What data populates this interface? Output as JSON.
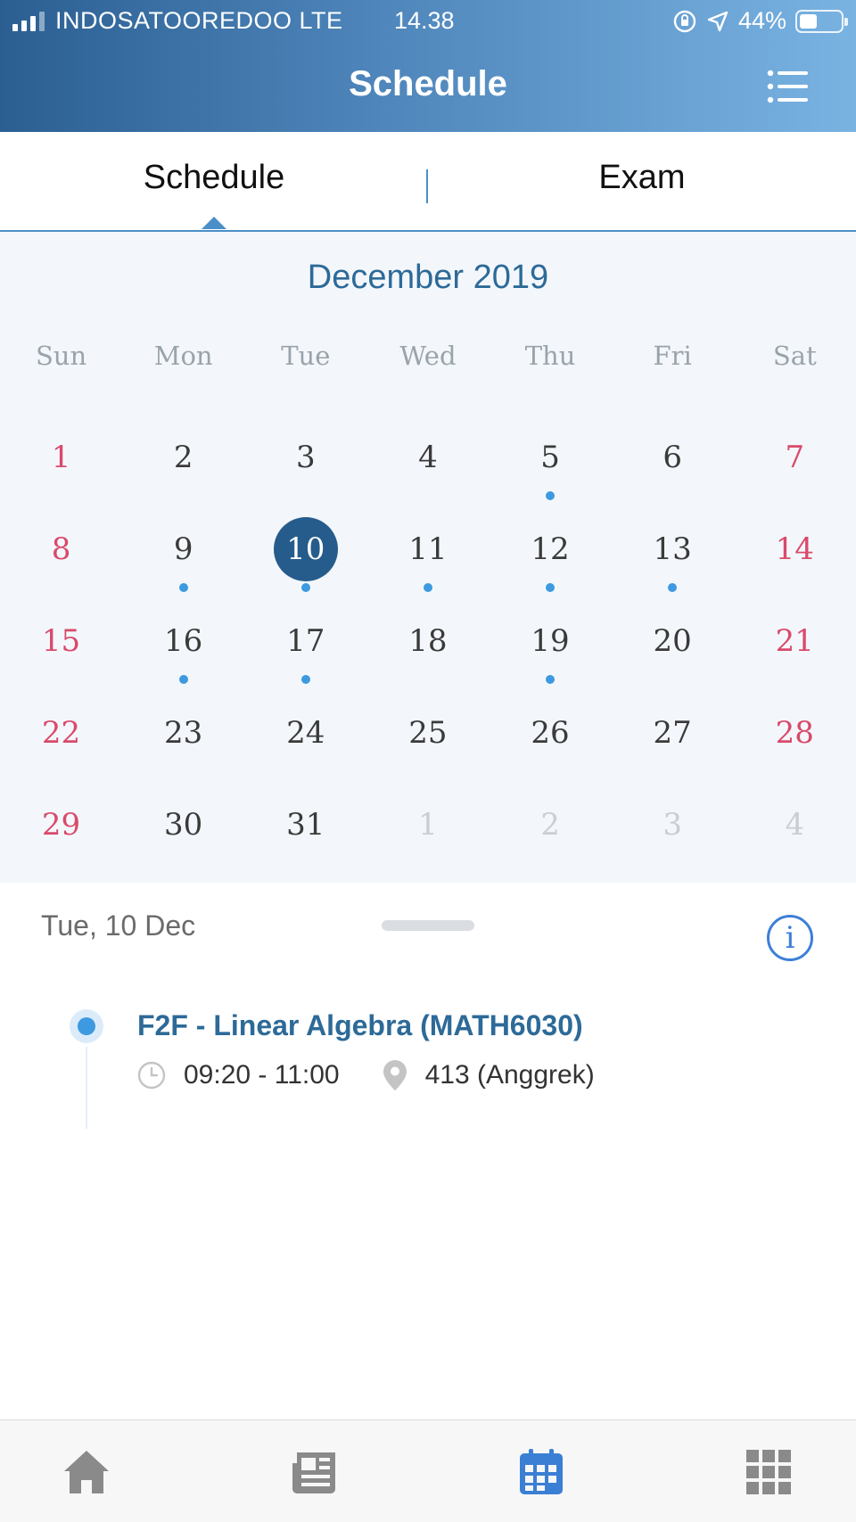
{
  "status_bar": {
    "carrier": "INDOSATOOREDOO LTE",
    "time": "14.38",
    "battery": "44%",
    "battery_level": 0.44
  },
  "header": {
    "title": "Schedule",
    "menu_icon": "list-menu-icon"
  },
  "tabs": [
    {
      "label": "Schedule",
      "active": true
    },
    {
      "label": "Exam",
      "active": false
    }
  ],
  "calendar": {
    "month_label": "December 2019",
    "weekdays": [
      "Sun",
      "Mon",
      "Tue",
      "Wed",
      "Thu",
      "Fri",
      "Sat"
    ],
    "weeks": [
      [
        {
          "d": "1",
          "t": "weekend"
        },
        {
          "d": "2"
        },
        {
          "d": "3"
        },
        {
          "d": "4"
        },
        {
          "d": "5",
          "dot": true
        },
        {
          "d": "6"
        },
        {
          "d": "7",
          "t": "weekend"
        }
      ],
      [
        {
          "d": "8",
          "t": "weekend"
        },
        {
          "d": "9",
          "dot": true
        },
        {
          "d": "10",
          "dot": true,
          "selected": true
        },
        {
          "d": "11",
          "dot": true
        },
        {
          "d": "12",
          "dot": true
        },
        {
          "d": "13",
          "dot": true
        },
        {
          "d": "14",
          "t": "weekend"
        }
      ],
      [
        {
          "d": "15",
          "t": "weekend"
        },
        {
          "d": "16",
          "dot": true
        },
        {
          "d": "17",
          "dot": true
        },
        {
          "d": "18"
        },
        {
          "d": "19",
          "dot": true
        },
        {
          "d": "20"
        },
        {
          "d": "21",
          "t": "weekend"
        }
      ],
      [
        {
          "d": "22",
          "t": "weekend"
        },
        {
          "d": "23"
        },
        {
          "d": "24"
        },
        {
          "d": "25"
        },
        {
          "d": "26"
        },
        {
          "d": "27"
        },
        {
          "d": "28",
          "t": "weekend"
        }
      ],
      [
        {
          "d": "29",
          "t": "weekend"
        },
        {
          "d": "30"
        },
        {
          "d": "31"
        },
        {
          "d": "1",
          "t": "other"
        },
        {
          "d": "2",
          "t": "other"
        },
        {
          "d": "3",
          "t": "other"
        },
        {
          "d": "4",
          "t": "other"
        }
      ]
    ]
  },
  "day": {
    "label": "Tue, 10 Dec",
    "info_glyph": "i",
    "events": [
      {
        "title": "F2F - Linear Algebra (MATH6030)",
        "time": "09:20 - 11:00",
        "location": "413 (Anggrek)"
      }
    ]
  },
  "bottom_nav": [
    {
      "icon": "home-icon",
      "active": false
    },
    {
      "icon": "news-icon",
      "active": false
    },
    {
      "icon": "calendar-icon",
      "active": true
    },
    {
      "icon": "apps-grid-icon",
      "active": false
    }
  ],
  "colors": {
    "accent": "#2d6a98",
    "selected_day": "#265c8c",
    "weekend": "#d94a6b",
    "event_dot": "#3d9ae0",
    "nav_active": "#3b7fd4",
    "nav_inactive": "#8a8a8a"
  }
}
